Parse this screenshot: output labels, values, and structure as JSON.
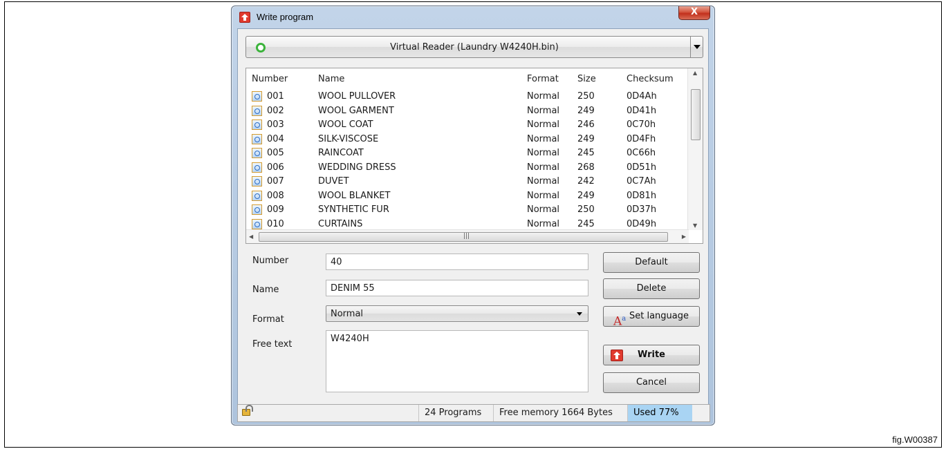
{
  "window": {
    "title": "Write program",
    "close_label": "X"
  },
  "device": {
    "label": "Virtual Reader (Laundry W4240H.bin)",
    "status_color": "#3bb33b"
  },
  "list": {
    "columns": [
      "Number",
      "Name",
      "Format",
      "Size",
      "Checksum"
    ],
    "rows": [
      {
        "number": "001",
        "name": "WOOL PULLOVER",
        "format": "Normal",
        "size": "250",
        "checksum": "0D4Ah"
      },
      {
        "number": "002",
        "name": "WOOL GARMENT",
        "format": "Normal",
        "size": "249",
        "checksum": "0D41h"
      },
      {
        "number": "003",
        "name": "WOOL COAT",
        "format": "Normal",
        "size": "246",
        "checksum": "0C70h"
      },
      {
        "number": "004",
        "name": "SILK-VISCOSE",
        "format": "Normal",
        "size": "249",
        "checksum": "0D4Fh"
      },
      {
        "number": "005",
        "name": "RAINCOAT",
        "format": "Normal",
        "size": "245",
        "checksum": "0C66h"
      },
      {
        "number": "006",
        "name": "WEDDING DRESS",
        "format": "Normal",
        "size": "268",
        "checksum": "0D51h"
      },
      {
        "number": "007",
        "name": "DUVET",
        "format": "Normal",
        "size": "242",
        "checksum": "0C7Ah"
      },
      {
        "number": "008",
        "name": "WOOL BLANKET",
        "format": "Normal",
        "size": "249",
        "checksum": "0D81h"
      },
      {
        "number": "009",
        "name": "SYNTHETIC FUR",
        "format": "Normal",
        "size": "250",
        "checksum": "0D37h"
      },
      {
        "number": "010",
        "name": "CURTAINS",
        "format": "Normal",
        "size": "245",
        "checksum": "0D49h"
      }
    ]
  },
  "form": {
    "number_label": "Number",
    "number_value": "40",
    "name_label": "Name",
    "name_value": "DENIM 55",
    "format_label": "Format",
    "format_value": "Normal",
    "freetext_label": "Free text",
    "freetext_value": "W4240H"
  },
  "buttons": {
    "default": "Default",
    "delete": "Delete",
    "set_language": "Set language",
    "write": "Write",
    "cancel": "Cancel"
  },
  "statusbar": {
    "programs": "24 Programs",
    "free_memory": "Free memory 1664 Bytes",
    "used": "Used 77%",
    "used_percent": 77
  },
  "figure_label": "fig.W00387",
  "colors": {
    "accent_red": "#e03a2e",
    "used_fill": "#a9d4f3"
  }
}
